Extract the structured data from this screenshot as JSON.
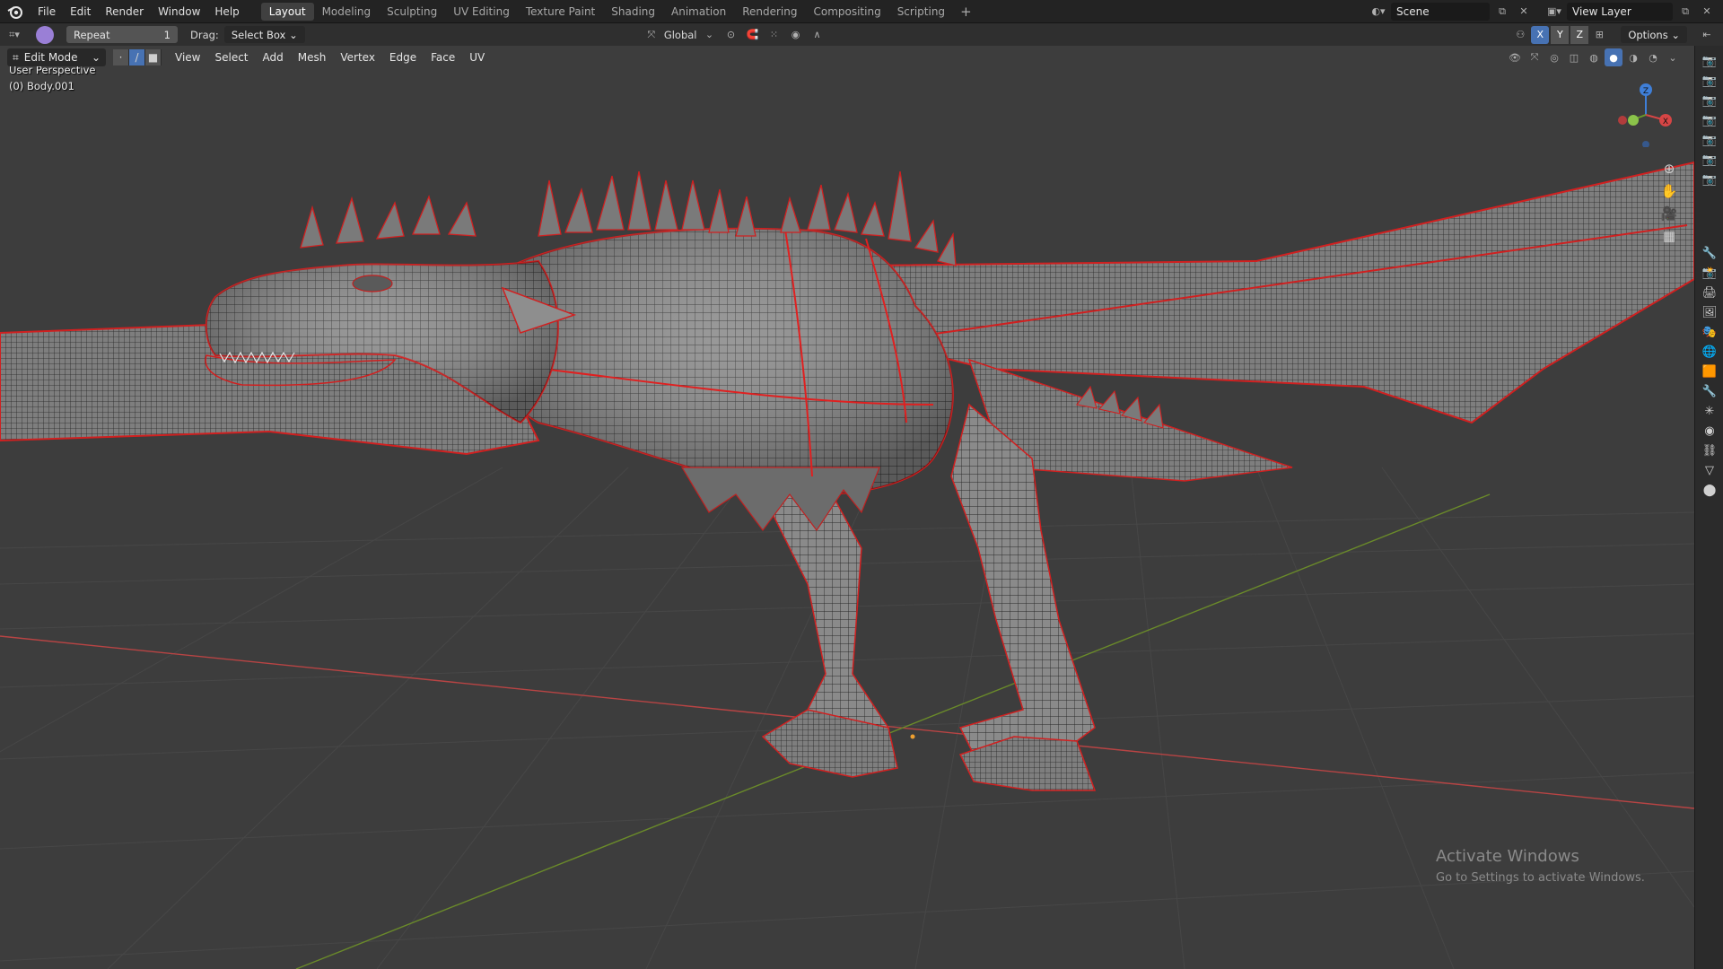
{
  "topbar": {
    "menus": [
      "File",
      "Edit",
      "Render",
      "Window",
      "Help"
    ],
    "workspaces": [
      "Layout",
      "Modeling",
      "Sculpting",
      "UV Editing",
      "Texture Paint",
      "Shading",
      "Animation",
      "Rendering",
      "Compositing",
      "Scripting"
    ],
    "active_workspace": "Layout",
    "add_tab": "+",
    "scene": "Scene",
    "view_layer": "View Layer"
  },
  "toolheader": {
    "repeat_label": "Repeat",
    "repeat_value": "1",
    "drag_label": "Drag:",
    "drag_value": "Select Box",
    "orientation": "Global",
    "axes": [
      "X",
      "Y",
      "Z"
    ],
    "options_label": "Options"
  },
  "viewport_header": {
    "mode": "Edit Mode",
    "menus": [
      "View",
      "Select",
      "Add",
      "Mesh",
      "Vertex",
      "Edge",
      "Face",
      "UV"
    ]
  },
  "viewport": {
    "perspective": "User Perspective",
    "object": "(0) Body.001",
    "gizmo_axes": [
      "Z",
      "Y",
      "X"
    ]
  },
  "watermark": {
    "title": "Activate Windows",
    "subtitle": "Go to Settings to activate Windows."
  },
  "colors": {
    "viewport_bg": "#3d3d3d",
    "accent": "#4772b3",
    "seam_red": "#e02020",
    "axis_x": "#d64545",
    "axis_y": "#6a9a2a"
  }
}
